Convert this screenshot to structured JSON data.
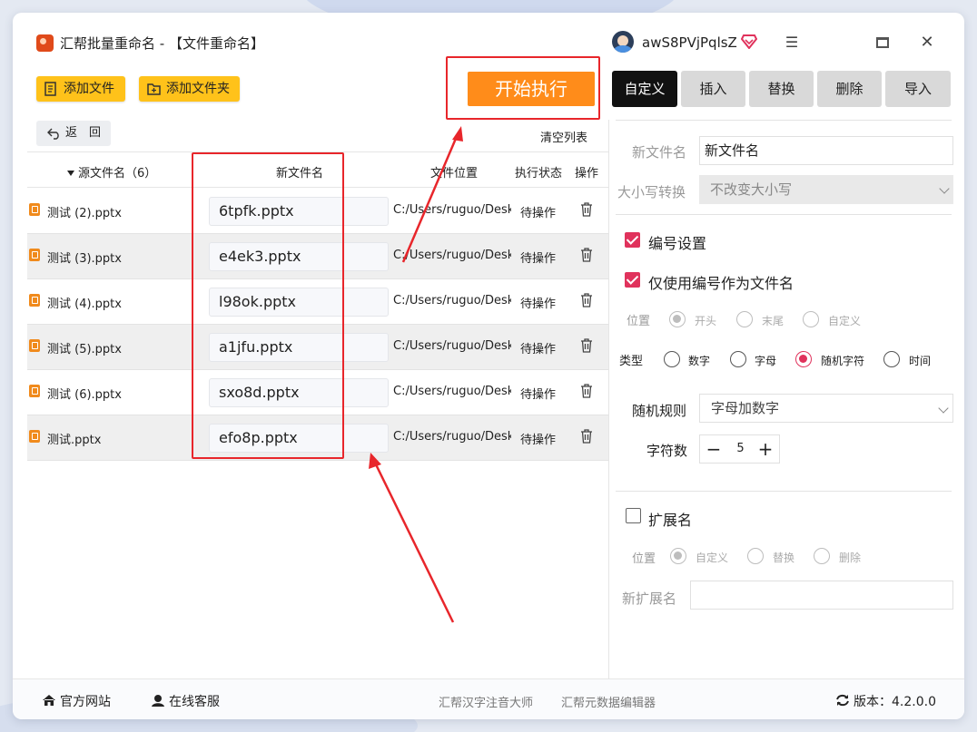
{
  "window": {
    "title": "汇帮批量重命名 - 【文件重命名】",
    "username": "awS8PVjPqlsZ"
  },
  "toolbar": {
    "add_file": "添加文件",
    "add_folder": "添加文件夹",
    "start": "开始执行",
    "back": "返　回",
    "clear_list": "清空列表"
  },
  "table": {
    "headers": {
      "source": "源文件名（6）",
      "new_name": "新文件名",
      "location": "文件位置",
      "state": "执行状态",
      "op": "操作"
    },
    "rows": [
      {
        "source": "测试 (2).pptx",
        "new_name": "6tpfk.pptx",
        "location": "C:/Users/ruguo/Desktop",
        "state": "待操作"
      },
      {
        "source": "测试 (3).pptx",
        "new_name": "e4ek3.pptx",
        "location": "C:/Users/ruguo/Desktop",
        "state": "待操作"
      },
      {
        "source": "测试 (4).pptx",
        "new_name": "l98ok.pptx",
        "location": "C:/Users/ruguo/Desktop",
        "state": "待操作"
      },
      {
        "source": "测试 (5).pptx",
        "new_name": "a1jfu.pptx",
        "location": "C:/Users/ruguo/Desktop",
        "state": "待操作"
      },
      {
        "source": "测试 (6).pptx",
        "new_name": "sxo8d.pptx",
        "location": "C:/Users/ruguo/Desktop",
        "state": "待操作"
      },
      {
        "source": "测试.pptx",
        "new_name": "efo8p.pptx",
        "location": "C:/Users/ruguo/Desktop",
        "state": "待操作"
      }
    ]
  },
  "tabs": [
    "自定义",
    "插入",
    "替换",
    "删除",
    "导入"
  ],
  "panel": {
    "new_name_label": "新文件名",
    "new_name_value": "新文件名",
    "case_label": "大小写转换",
    "case_value": "不改变大小写",
    "numbering": "编号设置",
    "numbering_checked": true,
    "only_number": "仅使用编号作为文件名",
    "only_number_checked": true,
    "position_label": "位置",
    "position_options": [
      "开头",
      "末尾",
      "自定义"
    ],
    "position_selected": "开头",
    "type_label": "类型",
    "type_options": [
      "数字",
      "字母",
      "随机字符",
      "时间"
    ],
    "type_selected": "随机字符",
    "random_rule_label": "随机规则",
    "random_rule_value": "字母加数字",
    "char_count_label": "字符数",
    "char_count": "5",
    "ext_label": "扩展名",
    "ext_checked": false,
    "ext_position_label": "位置",
    "ext_position_options": [
      "自定义",
      "替换",
      "删除"
    ],
    "ext_position_selected": "自定义",
    "new_ext_label": "新扩展名",
    "new_ext_value": ""
  },
  "footer": {
    "website": "官方网站",
    "service": "在线客服",
    "link1": "汇帮汉字注音大师",
    "link2": "汇帮元数据编辑器",
    "version": "版本：4.2.0.0"
  },
  "colors": {
    "accent": "#e0325c",
    "start_button": "#ff8c1a",
    "yellow_button": "#ffc21a",
    "annotation_red": "#e8262b"
  }
}
